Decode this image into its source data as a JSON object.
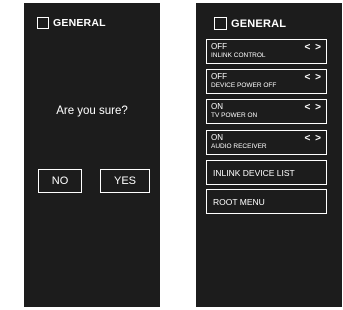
{
  "left_screen": {
    "header": "GENERAL",
    "question": "Are you sure?",
    "no_label": "NO",
    "yes_label": "YES"
  },
  "right_screen": {
    "header": "GENERAL",
    "settings": [
      {
        "value": "OFF",
        "label": "INLINK CONTROL",
        "arrows": "< >"
      },
      {
        "value": "OFF",
        "label": "DEVICE POWER OFF",
        "arrows": "< >"
      },
      {
        "value": "ON",
        "label": "TV POWER ON",
        "arrows": "< >"
      },
      {
        "value": "ON",
        "label": "AUDIO RECEIVER",
        "arrows": "< >"
      }
    ],
    "links": [
      {
        "label": "INLINK DEVICE LIST"
      },
      {
        "label": "ROOT MENU"
      }
    ]
  },
  "colors": {
    "panel_bg": "#1c1c1c",
    "text": "#ffffff"
  }
}
